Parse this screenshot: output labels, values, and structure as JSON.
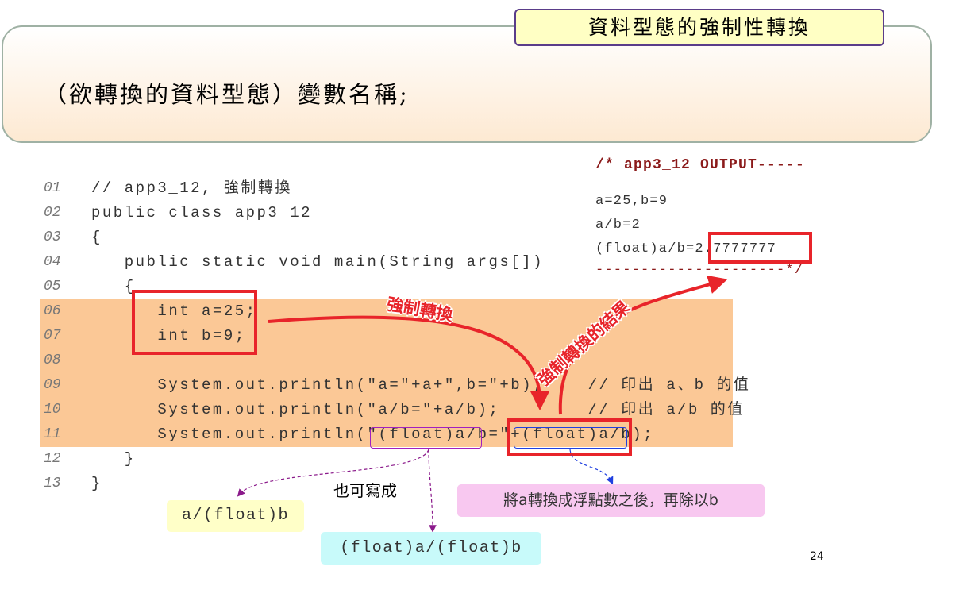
{
  "slide_title": "資料型態的強制性轉換",
  "syntax": "（欲轉換的資料型態）變數名稱;",
  "code": [
    {
      "n": "01",
      "text": "// app3_12, 強制轉換"
    },
    {
      "n": "02",
      "text": "public class app3_12"
    },
    {
      "n": "03",
      "text": "{"
    },
    {
      "n": "04",
      "text": "   public static void main(String args[])"
    },
    {
      "n": "05",
      "text": "   {"
    },
    {
      "n": "06",
      "text": "      int a=25;"
    },
    {
      "n": "07",
      "text": "      int b=9;"
    },
    {
      "n": "08",
      "text": ""
    },
    {
      "n": "09",
      "text": "      System.out.println(\"a=\"+a+\",b=\"+b);    // 印出 a、b 的值"
    },
    {
      "n": "10",
      "text": "      System.out.println(\"a/b=\"+a/b);        // 印出 a/b 的值"
    },
    {
      "n": "11",
      "text": "      System.out.println(\"(float)a/b=\"+(float)a/b);"
    },
    {
      "n": "12",
      "text": "   }"
    },
    {
      "n": "13",
      "text": "}"
    }
  ],
  "output": {
    "header": "/* app3_12 OUTPUT-----",
    "lines": [
      "a=25,b=9",
      "a/b=2",
      "(float)a/b=2.7777777"
    ],
    "footer": "---------------------*/"
  },
  "annotations": {
    "cast_label": "強制轉換",
    "result_label": "強制轉換的結果",
    "alt_label": "也可寫成",
    "alt1": "a/(float)b",
    "alt2": "(float)a/(float)b",
    "explain": "將a轉換成浮點數之後，再除以b"
  },
  "page_number": "24"
}
